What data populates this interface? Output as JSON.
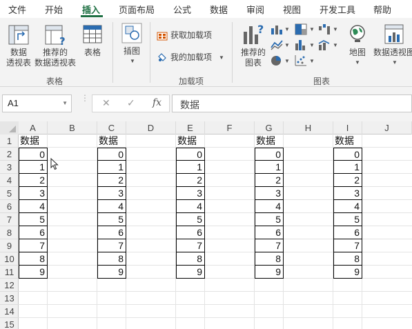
{
  "ribbon_tabs": [
    "文件",
    "开始",
    "插入",
    "页面布局",
    "公式",
    "数据",
    "审阅",
    "视图",
    "开发工具",
    "帮助"
  ],
  "active_tab": "插入",
  "ribbon": {
    "tables_group": {
      "name": "表格",
      "pivot_table_l1": "数据",
      "pivot_table_l2": "透视表",
      "recommended_pivot_l1": "推荐的",
      "recommended_pivot_l2": "数据透视表",
      "table": "表格"
    },
    "illustrations": {
      "label": "插图"
    },
    "addins_group": {
      "name": "加载项",
      "get_addins": "获取加载项",
      "my_addins": "我的加载项"
    },
    "charts_group": {
      "name": "图表",
      "recommended_charts_l1": "推荐的",
      "recommended_charts_l2": "图表",
      "map": "地图",
      "pivot_chart": "数据透视图"
    }
  },
  "formula_bar": {
    "name_box": "A1",
    "cancel": "✕",
    "enter": "✓",
    "fx": "fx",
    "content": "数据"
  },
  "columns": [
    "A",
    "B",
    "C",
    "D",
    "E",
    "F",
    "G",
    "H",
    "I",
    "J"
  ],
  "rows": [
    "1",
    "2",
    "3",
    "4",
    "5",
    "6",
    "7",
    "8",
    "9",
    "10",
    "11",
    "12",
    "13",
    "14",
    "15"
  ],
  "sheet": {
    "header": "数据",
    "values": [
      "0",
      "1",
      "2",
      "3",
      "4",
      "5",
      "6",
      "7",
      "8",
      "9"
    ]
  },
  "colors": {
    "accent": "#1d6f42",
    "ribbon_bg": "#f3f3f3",
    "header_bg": "#f0f0f0"
  }
}
